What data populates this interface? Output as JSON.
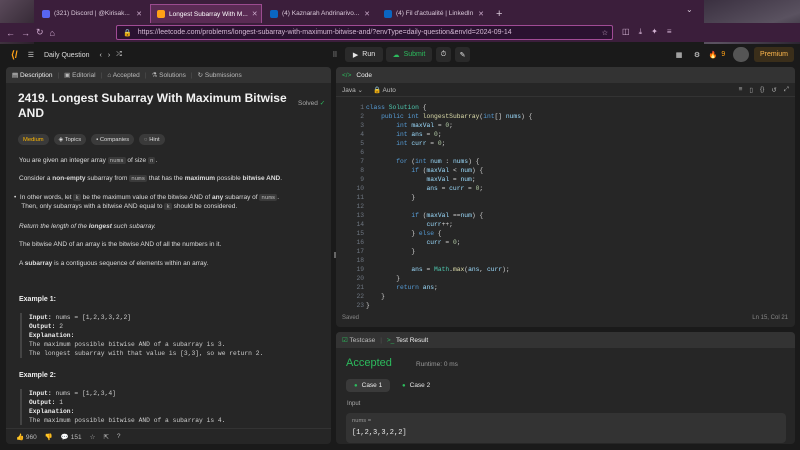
{
  "browser": {
    "tabs": [
      {
        "label": "(321) Discord | @Kirisak...",
        "color": "#5865f2",
        "active": false
      },
      {
        "label": "Longest Subarray With M...",
        "color": "#ffa116",
        "active": true
      },
      {
        "label": "(4) Kaznarah Andrinarivo...",
        "color": "#0a66c2",
        "active": false
      },
      {
        "label": "(4) Fil d'actualité | LinkedIn",
        "color": "#0a66c2",
        "active": false
      }
    ],
    "url": "https://leetcode.com/problems/longest-subarray-with-maximum-bitwise-and/?envType=daily-question&envId=2024-09-14"
  },
  "lcnav": {
    "daily": "Daily Question",
    "run": "Run",
    "submit": "Submit",
    "streak": "9",
    "premium": "Premium"
  },
  "left": {
    "tabs": {
      "description": "Description",
      "editorial": "Editorial",
      "accepted": "Accepted",
      "solutions": "Solutions",
      "submissions": "Submissions"
    },
    "title": "2419. Longest Subarray With Maximum Bitwise AND",
    "solved": "Solved",
    "chips": {
      "difficulty": "Medium",
      "topics": "Topics",
      "companies": "Companies",
      "hint": "Hint"
    },
    "p1a": "You are given an integer array ",
    "p1code": "nums",
    "p1b": " of size ",
    "p1code2": "n",
    "p1c": ".",
    "p2a": "Consider a ",
    "p2b": "non-empty",
    "p2c": " subarray from ",
    "p2code": "nums",
    "p2d": " that has the ",
    "p2e": "maximum",
    "p2f": " possible ",
    "p2g": "bitwise AND",
    "p2h": ".",
    "b1a": "In other words, let ",
    "b1k": "k",
    "b1b": " be the maximum value of the bitwise AND of ",
    "b1c": "any",
    "b1d": " subarray of ",
    "b1code": "nums",
    "b1e": ".",
    "b2a": "Then, only subarrays with a bitwise AND equal to ",
    "b2k": "k",
    "b2b": " should be considered.",
    "p3a": "Return the length of the ",
    "p3b": "longest",
    "p3c": " such subarray.",
    "p4": "The bitwise AND of an array is the bitwise AND of all the numbers in it.",
    "p5a": "A ",
    "p5b": "subarray",
    "p5c": " is a contiguous sequence of elements within an array.",
    "ex1": {
      "title": "Example 1:",
      "input_label": "Input:",
      "input": " nums = [1,2,3,3,2,2]",
      "output_label": "Output:",
      "output": " 2",
      "expl_label": "Explanation:",
      "expl1": "The maximum possible bitwise AND of a subarray is 3.",
      "expl2": "The longest subarray with that value is [3,3], so we return 2."
    },
    "ex2": {
      "title": "Example 2:",
      "input_label": "Input:",
      "input": " nums = [1,2,3,4]",
      "output_label": "Output:",
      "output": " 1",
      "expl_label": "Explanation:",
      "expl1": "The maximum possible bitwise AND of a subarray is 4."
    },
    "footer": {
      "likes": "960",
      "comments": "151"
    }
  },
  "code": {
    "header": "Code",
    "language": "Java",
    "mode": "Auto",
    "saved": "Saved",
    "cursor": "Ln 15, Col 21",
    "lines": [
      "class Solution {",
      "    public int longestSubarray(int[] nums) {",
      "        int maxVal = 0;",
      "        int ans = 0;",
      "        int curr = 0;",
      "",
      "        for (int num : nums) {",
      "            if (maxVal < num) {",
      "                maxVal = num;",
      "                ans = curr = 0;",
      "            }",
      "",
      "            if (maxVal ==num) {",
      "                curr++;",
      "            } else {",
      "                curr = 0;",
      "            }",
      "",
      "            ans = Math.max(ans, curr);",
      "        }",
      "        return ans;",
      "    }",
      "}"
    ]
  },
  "result": {
    "testcase": "Testcase",
    "testresult": "Test Result",
    "status": "Accepted",
    "runtime": "Runtime: 0 ms",
    "case1": "Case 1",
    "case2": "Case 2",
    "input_label": "Input",
    "var": "nums =",
    "value": "[1,2,3,3,2,2]"
  }
}
